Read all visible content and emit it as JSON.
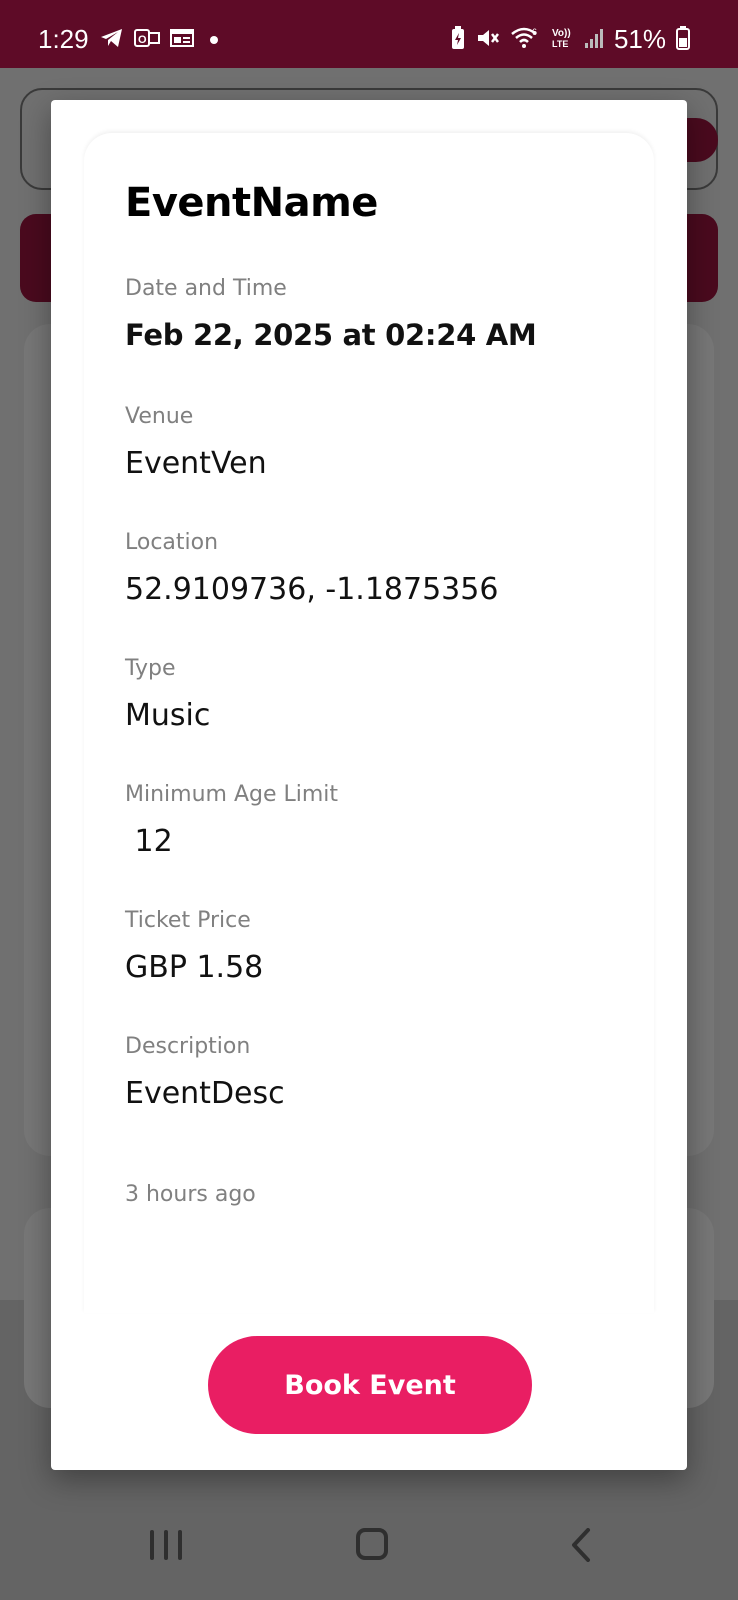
{
  "status_bar": {
    "time": "1:29",
    "battery": "51%",
    "icons_left": [
      "telegram-icon",
      "outlook-icon",
      "news-icon",
      "notification-dot"
    ],
    "icons_right": [
      "battery-saver-icon",
      "mute-icon",
      "wifi-icon",
      "volte-icon",
      "signal-icon",
      "battery-icon"
    ],
    "volte_text": "Vo)) LTE"
  },
  "modal": {
    "title": "EventName",
    "fields": [
      {
        "label": "Date and Time",
        "value": "Feb 22, 2025 at 02:24 AM",
        "bold": true
      },
      {
        "label": "Venue",
        "value": "EventVen"
      },
      {
        "label": "Location",
        "value": "52.9109736, -1.1875356"
      },
      {
        "label": "Type",
        "value": "Music"
      },
      {
        "label": "Minimum Age Limit",
        "value": " 12"
      },
      {
        "label": "Ticket Price",
        "value": "GBP 1.58"
      },
      {
        "label": "Description",
        "value": "EventDesc"
      }
    ],
    "time_ago": "3 hours ago",
    "book_button": "Book Event"
  },
  "colors": {
    "status_bar": "#5e0b27",
    "accent": "#e91e63",
    "label_gray": "#808080"
  }
}
